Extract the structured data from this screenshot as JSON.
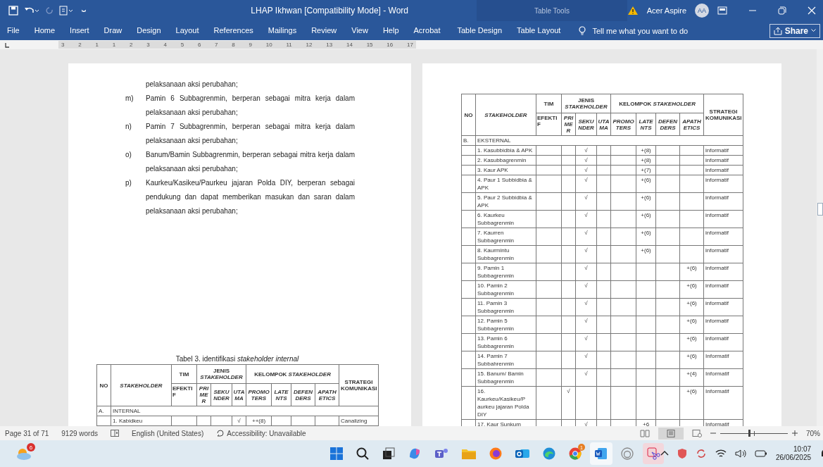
{
  "title_bar": {
    "title": "LHAP Ikhwan [Compatibility Mode]  -  Word",
    "context": "Table Tools",
    "account": "Acer Aspire",
    "avatar": "AA"
  },
  "tabs": [
    {
      "label": "File",
      "selected": false
    },
    {
      "label": "Home",
      "selected": false
    },
    {
      "label": "Insert",
      "selected": false
    },
    {
      "label": "Draw",
      "selected": false
    },
    {
      "label": "Design",
      "selected": false
    },
    {
      "label": "Layout",
      "selected": false
    },
    {
      "label": "References",
      "selected": false
    },
    {
      "label": "Mailings",
      "selected": false
    },
    {
      "label": "Review",
      "selected": false
    },
    {
      "label": "View",
      "selected": false
    },
    {
      "label": "Help",
      "selected": false
    },
    {
      "label": "Acrobat",
      "selected": false
    },
    {
      "label": "Table Design",
      "selected": false
    },
    {
      "label": "Table Layout",
      "selected": false
    }
  ],
  "tell_me": {
    "placeholder": "Tell me what you want to do"
  },
  "share": "Share",
  "ruler": [
    "3",
    "2",
    "1",
    "1",
    "2",
    "3",
    "4",
    "5",
    "6",
    "7",
    "8",
    "9",
    "10",
    "11",
    "12",
    "13",
    "14",
    "15",
    "16",
    "17"
  ],
  "left_page": {
    "items": [
      {
        "text": "pelaksanaan aksi perubahan;"
      },
      {
        "marker": "m)",
        "text": "Pamin 6 Subbagrenmin, berperan sebagai mitra kerja dalam pelaksanaan aksi perubahan;"
      },
      {
        "marker": "n)",
        "text": "Pamin 7 Subbagrenmin, berperan sebagai mitra kerja dalam pelaksanaan aksi perubahan;"
      },
      {
        "marker": "o)",
        "text": "Banum/Bamin Subbagrenmin, berperan sebagai mitra kerja dalam pelaksanaan aksi perubahan;"
      },
      {
        "marker": "p)",
        "text": "Kaurkeu/Kasikeu/Paurkeu jajaran Polda DIY, berperan sebagai pendukung dan dapat memberikan masukan dan saran dalam pelaksanaan aksi perubahan;"
      }
    ],
    "caption": "Tabel 3.  identifikasi *stakeholder internal*",
    "table": {
      "header": {
        "no": "NO",
        "stakeholder": "STAKEHOLDER",
        "tim": "TIM",
        "tim_sub": "EFEKTIF",
        "jenis": "JENIS *STAKEHOLDER*",
        "jenis_cols": [
          "PRIMER",
          "SEKUNDER",
          "UTAMA"
        ],
        "kelompok": "KELOMPOK *STAKEHOLDER*",
        "kelompok_cols": [
          "PROMOTERS",
          "LATENTS",
          "DEFENDERS",
          "APATHETICS"
        ],
        "strategi": "STRATEGI KOMUNIKASI"
      },
      "rows": [
        {
          "kind": "section",
          "no": "A.",
          "label": "INTERNAL"
        },
        {
          "kind": "row",
          "name": "1.  Kabidkeu",
          "utama": "√",
          "promoters": "++(8)",
          "strategi": "Canalizing"
        }
      ]
    }
  },
  "right_page": {
    "table": {
      "header": {
        "no": "NO",
        "stakeholder": "STAKEHOLDER",
        "tim": "TIM",
        "tim_sub": "EFEKTIF",
        "jenis": "JENIS *STAKEHOLDER*",
        "jenis_cols": [
          "PRIMER",
          "SEKUNDER",
          "UTAMA"
        ],
        "kelompok": "KELOMPOK *STAKEHOLDER*",
        "kelompok_cols": [
          "PROMOTERS",
          "LATENTS",
          "DEFENDERS",
          "APATHETICS"
        ],
        "strategi": "STRATEGI KOMUNIKASI"
      },
      "rows": [
        {
          "kind": "section",
          "no": "B.",
          "label": "EKSTERNAL"
        },
        {
          "kind": "row",
          "name": "1.  Kasubbidbia & APK",
          "sekunder": "√",
          "latents": "+(8)",
          "strategi": "informatif"
        },
        {
          "kind": "row",
          "name": "2.  Kasubbagrenmin",
          "sekunder": "√",
          "latents": "+(8)",
          "strategi": "informatif"
        },
        {
          "kind": "row",
          "name": "3.  Kaur APK",
          "sekunder": "√",
          "latents": "+(7)",
          "strategi": "informatif"
        },
        {
          "kind": "row",
          "name": "4.  Paur 1 Subbidbia & APK",
          "sekunder": "√",
          "latents": "+(6)",
          "strategi": "informatif"
        },
        {
          "kind": "row",
          "name": "5.  Paur 2 Subbidbia & APK",
          "sekunder": "√",
          "latents": "+(6)",
          "strategi": "informatif"
        },
        {
          "kind": "row",
          "name": "6.  Kaurkeu Subbagrenmin",
          "sekunder": "√",
          "latents": "+(6)",
          "strategi": "informatif"
        },
        {
          "kind": "row",
          "name": "7.  Kaurren Subbagrenmin",
          "sekunder": "√",
          "latents": "+(6)",
          "strategi": "informatif"
        },
        {
          "kind": "row",
          "name": "8.  Kaurmintu Subbagrenmin",
          "sekunder": "√",
          "latents": "+(6)",
          "strategi": "informatif"
        },
        {
          "kind": "row",
          "name": "9.  Pamin 1 Subbagrenmin",
          "sekunder": "√",
          "apathetics": "+(6)",
          "strategi": "informatif"
        },
        {
          "kind": "row",
          "name": "10. Pamin 2 Subbagrenmin",
          "sekunder": "√",
          "apathetics": "+(6)",
          "strategi": "informatif"
        },
        {
          "kind": "row",
          "name": "11. Pamin 3 Subbagrenmin",
          "sekunder": "√",
          "apathetics": "+(6)",
          "strategi": "informatif"
        },
        {
          "kind": "row",
          "name": "12. Pamin 5 Subbagrenmin",
          "sekunder": "√",
          "apathetics": "+(6)",
          "strategi": "informatif"
        },
        {
          "kind": "row",
          "name": "13. Pamin 6 Subbagrenmin",
          "sekunder": "√",
          "apathetics": "+(6)",
          "strategi": "informatif"
        },
        {
          "kind": "row",
          "name": "14. Pamin 7 Subbahrenmin",
          "sekunder": "√",
          "apathetics": "+(6)",
          "strategi": "Informatif"
        },
        {
          "kind": "row",
          "name": "15. Banum/ Bamin Subbagrenmin",
          "sekunder": "√",
          "apathetics": "+(4)",
          "strategi": "Informatif"
        },
        {
          "kind": "row",
          "name": "16. Kaurkeu/Kasikeu/P aurkeu jajaran Polda DIY",
          "primer": "√",
          "apathetics": "+(6)",
          "strategi": "Informatif"
        },
        {
          "kind": "row",
          "name": "17. Kaur Sunkum",
          "sekunder": "√",
          "latents": "+6",
          "strategi": "Informatif"
        }
      ]
    }
  },
  "status_bar": {
    "page": "Page 31 of 71",
    "words": "9129 words",
    "language": "English (United States)",
    "accessibility": "Accessibility: Unavailable",
    "zoom": {
      "level": 0.42,
      "reading": "70%"
    }
  },
  "taskbar": {
    "weather_badge": "6",
    "chrome_badge": "1",
    "time": "10:07",
    "date": "26/06/2025"
  }
}
